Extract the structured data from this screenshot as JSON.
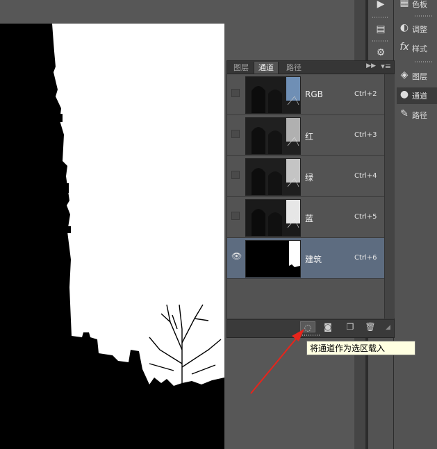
{
  "panel": {
    "tabs": [
      {
        "label": "图层",
        "active": false
      },
      {
        "label": "通道",
        "active": true
      },
      {
        "label": "路径",
        "active": false
      }
    ],
    "collapse_icon": "double-chevron-right-icon",
    "menu_icon": "panel-menu-icon"
  },
  "channels": [
    {
      "name": "RGB",
      "shortcut": "Ctrl+2",
      "visible": false,
      "selected": false
    },
    {
      "name": "红",
      "shortcut": "Ctrl+3",
      "visible": false,
      "selected": false
    },
    {
      "name": "绿",
      "shortcut": "Ctrl+4",
      "visible": false,
      "selected": false
    },
    {
      "name": "蓝",
      "shortcut": "Ctrl+5",
      "visible": false,
      "selected": false
    },
    {
      "name": "建筑",
      "shortcut": "Ctrl+6",
      "visible": true,
      "selected": true
    }
  ],
  "bottom_buttons": [
    {
      "icon": "load-channel-as-selection-icon",
      "hover": true
    },
    {
      "icon": "save-selection-as-channel-icon",
      "hover": false
    },
    {
      "icon": "new-channel-icon",
      "hover": false
    },
    {
      "icon": "trash-icon",
      "hover": false
    }
  ],
  "tooltip": "将通道作为选区载入",
  "right_panel": {
    "items": [
      {
        "label": "色板",
        "icon": "swatches-icon",
        "active": false
      },
      {
        "label": "调整",
        "icon": "adjustments-icon",
        "active": false
      },
      {
        "label": "样式",
        "icon": "styles-icon",
        "active": false
      },
      {
        "label": "图层",
        "icon": "layers-icon",
        "active": false
      },
      {
        "label": "通道",
        "icon": "channels-icon",
        "active": true
      },
      {
        "label": "路径",
        "icon": "paths-icon",
        "active": false
      }
    ]
  },
  "colors": {
    "selected_row": "#5d6c80",
    "tooltip_bg": "#ffffe1",
    "arrow": "#e8241b"
  }
}
